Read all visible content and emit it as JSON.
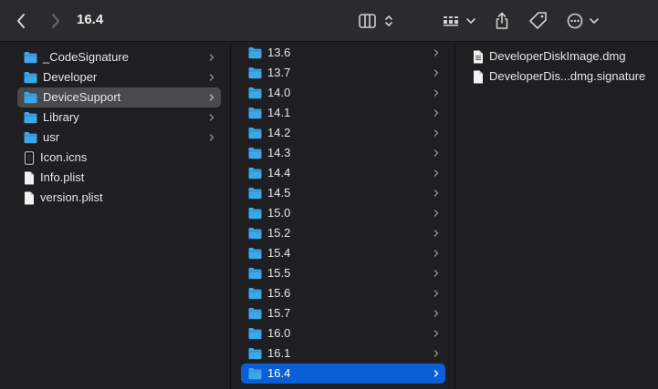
{
  "window": {
    "title": "16.4",
    "toolbar": {
      "back_icon": "chevron-left-icon",
      "forward_icon": "chevron-right-icon",
      "view_icon": "column-view-icon",
      "group_icon": "group-grid-icon",
      "share_icon": "share-icon",
      "tag_icon": "tag-icon",
      "more_icon": "ellipsis-circle-icon"
    }
  },
  "columns": {
    "first": [
      {
        "label": "_CodeSignature",
        "icon": "folder-icon"
      },
      {
        "label": "Developer",
        "icon": "folder-icon"
      },
      {
        "label": "DeviceSupport",
        "icon": "folder-icon"
      },
      {
        "label": "Library",
        "icon": "folder-icon"
      },
      {
        "label": "usr",
        "icon": "folder-icon"
      },
      {
        "label": "Icon.icns",
        "icon": "icns-file-icon"
      },
      {
        "label": "Info.plist",
        "icon": "document-icon"
      },
      {
        "label": "version.plist",
        "icon": "document-icon"
      }
    ],
    "second": [
      {
        "label": "13.6"
      },
      {
        "label": "13.7"
      },
      {
        "label": "14.0"
      },
      {
        "label": "14.1"
      },
      {
        "label": "14.2"
      },
      {
        "label": "14.3"
      },
      {
        "label": "14.4"
      },
      {
        "label": "14.5"
      },
      {
        "label": "15.0"
      },
      {
        "label": "15.2"
      },
      {
        "label": "15.4"
      },
      {
        "label": "15.5"
      },
      {
        "label": "15.6"
      },
      {
        "label": "15.7"
      },
      {
        "label": "16.0"
      },
      {
        "label": "16.1"
      },
      {
        "label": "16.4"
      }
    ],
    "third": [
      {
        "label": "DeveloperDiskImage.dmg",
        "icon": "disk-image-icon"
      },
      {
        "label": "DeveloperDis...dmg.signature",
        "icon": "document-icon"
      }
    ]
  },
  "colors": {
    "selection_active": "#0b5fd6",
    "selection_inactive": "#4a494c",
    "folder": "#3fa6e8"
  }
}
